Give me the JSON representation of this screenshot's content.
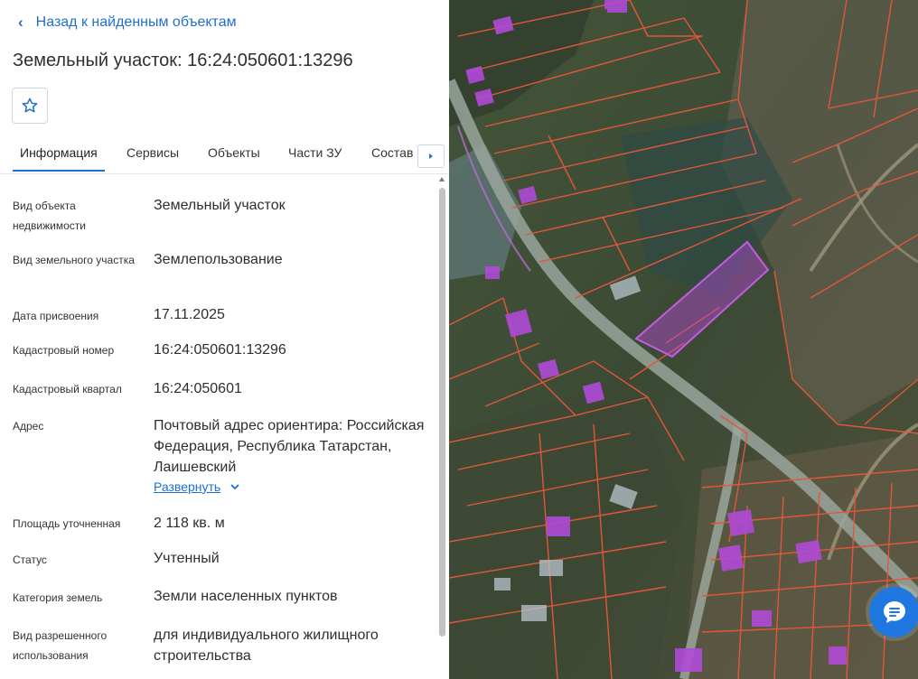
{
  "panel": {
    "back_label": "Назад к найденным объектам",
    "title": "Земельный участок: 16:24:050601:13296",
    "tabs": [
      {
        "label": "Информация",
        "active": true
      },
      {
        "label": "Сервисы"
      },
      {
        "label": "Объекты"
      },
      {
        "label": "Части ЗУ"
      },
      {
        "label": "Состав"
      }
    ],
    "info": [
      {
        "label": "Вид объекта недвижимости",
        "value": "Земельный участок"
      },
      {
        "label": "Вид земельного участка",
        "value": "Землепользование"
      },
      {
        "label": "Дата присвоения",
        "value": "17.11.2025"
      },
      {
        "label": "Кадастровый номер",
        "value": "16:24:050601:13296"
      },
      {
        "label": "Кадастровый квартал",
        "value": "16:24:050601"
      },
      {
        "label": "Адрес",
        "value": "Почтовый адрес ориентира: Российская Федерация, Республика Татарстан, Лаишевский"
      },
      {
        "label": "Площадь уточненная",
        "value": "2 118 кв. м"
      },
      {
        "label": "Статус",
        "value": "Учтенный"
      },
      {
        "label": "Категория земель",
        "value": "Земли населенных пунктов"
      },
      {
        "label": "Вид разрешенного использования",
        "value": "для индивидуального жилищного строительства"
      }
    ],
    "expand_label": "Развернуть"
  },
  "colors": {
    "accent": "#1f6fd1",
    "parcel_border": "#e2573a",
    "selected_parcel": "#b84ad6",
    "building_fill": "#b04ad8"
  },
  "icons": {
    "back": "chevron-left-icon",
    "favorite": "star-icon",
    "tabs_scroll": "triangle-right-icon",
    "expand": "chevron-down-icon",
    "chat": "chat-bubble-icon"
  }
}
